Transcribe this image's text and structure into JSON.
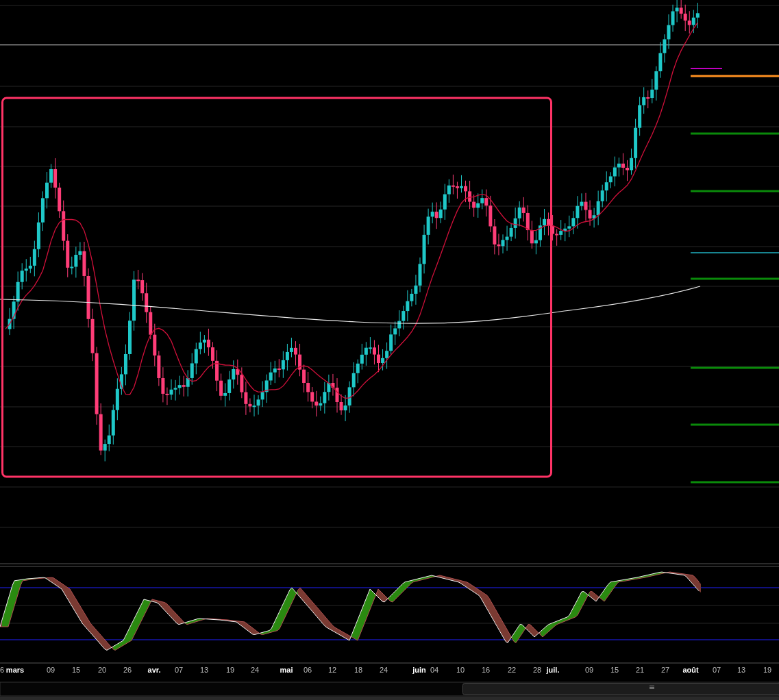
{
  "x_axis": {
    "labels": [
      {
        "text": "6",
        "kind": "day"
      },
      {
        "text": "mars",
        "kind": "month"
      },
      {
        "text": "09",
        "kind": "day"
      },
      {
        "text": "15",
        "kind": "day"
      },
      {
        "text": "20",
        "kind": "day"
      },
      {
        "text": "26",
        "kind": "day"
      },
      {
        "text": "avr.",
        "kind": "month"
      },
      {
        "text": "07",
        "kind": "day"
      },
      {
        "text": "13",
        "kind": "day"
      },
      {
        "text": "19",
        "kind": "day"
      },
      {
        "text": "24",
        "kind": "day"
      },
      {
        "text": "mai",
        "kind": "month"
      },
      {
        "text": "06",
        "kind": "day"
      },
      {
        "text": "12",
        "kind": "day"
      },
      {
        "text": "18",
        "kind": "day"
      },
      {
        "text": "24",
        "kind": "day"
      },
      {
        "text": "juin",
        "kind": "month"
      },
      {
        "text": "04",
        "kind": "day"
      },
      {
        "text": "10",
        "kind": "day"
      },
      {
        "text": "16",
        "kind": "day"
      },
      {
        "text": "22",
        "kind": "day"
      },
      {
        "text": "28",
        "kind": "day"
      },
      {
        "text": "juil.",
        "kind": "month"
      },
      {
        "text": "09",
        "kind": "day"
      },
      {
        "text": "15",
        "kind": "day"
      },
      {
        "text": "21",
        "kind": "day"
      },
      {
        "text": "27",
        "kind": "day"
      },
      {
        "text": "août",
        "kind": "month"
      },
      {
        "text": "07",
        "kind": "day"
      },
      {
        "text": "13",
        "kind": "day"
      },
      {
        "text": "19",
        "kind": "day"
      }
    ]
  }
}
